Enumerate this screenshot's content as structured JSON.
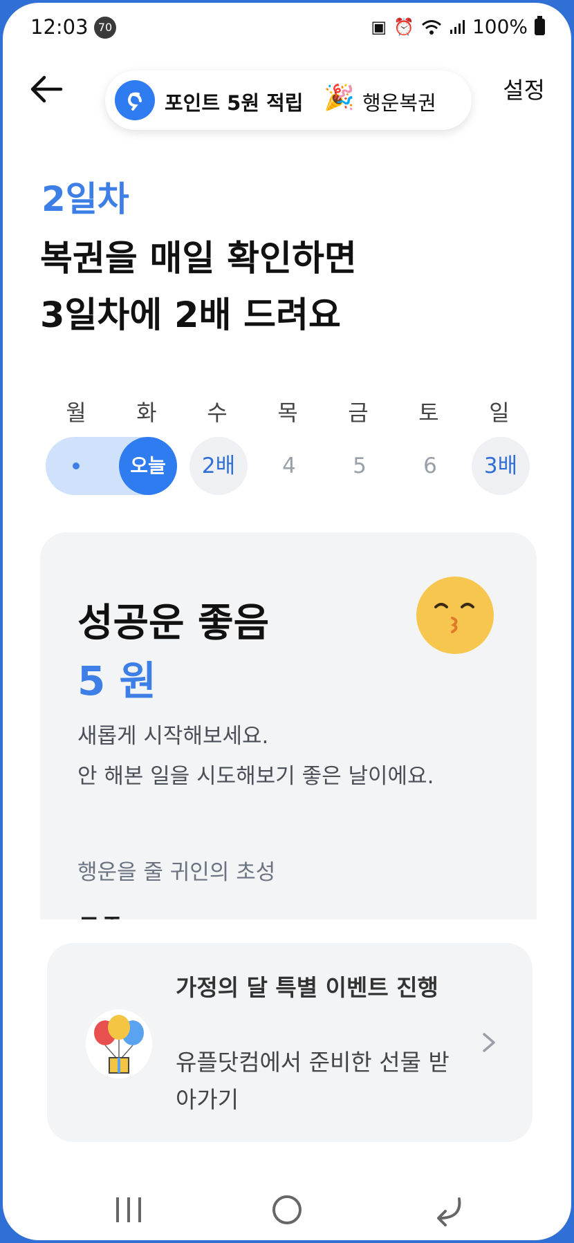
{
  "status_bar": {
    "time": "12:03",
    "notification_count": "70",
    "battery": "100%"
  },
  "header": {
    "point_text": "포인트 5원 적립",
    "party_icon": "party-popper-icon",
    "point_suffix": "행운복권",
    "settings_label": "설정"
  },
  "intro": {
    "day_label": "2일차",
    "headline_line1": "복권을 매일 확인하면",
    "headline_line2": "3일차에 2배 드려요"
  },
  "week": {
    "weekdays": [
      "월",
      "화",
      "수",
      "목",
      "금",
      "토",
      "일"
    ],
    "today_label": "오늘",
    "day3_label": "2배",
    "day4_label": "4",
    "day5_label": "5",
    "day6_label": "6",
    "day7_label": "3배"
  },
  "fortune": {
    "title": "성공운 좋음",
    "amount": "5 원",
    "emoji": "kissing-face-icon",
    "desc_line1": "새롭게 시작해보세요.",
    "desc_line2": "안 해본 일을 시도해보기 좋은 날이에요.",
    "helper_label": "행운을 줄 귀인의 초성",
    "helper_value": "ㅁㅈ"
  },
  "event": {
    "title": "가정의 달 특별 이벤트 진행",
    "body": "유플닷컴에서 준비한 선물 받아가기",
    "icon": "balloons-gift-icon"
  },
  "colors": {
    "accent": "#2f7bf0",
    "accent_text": "#3d7fe6",
    "frame": "#2f6fd6",
    "card_bg": "#f2f4f6"
  }
}
